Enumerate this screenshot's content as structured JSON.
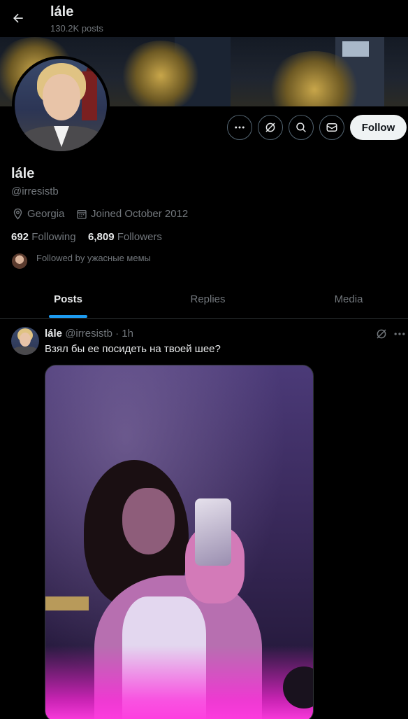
{
  "header": {
    "name": "lále",
    "post_count": "130.2K posts"
  },
  "profile": {
    "display_name": "lále",
    "handle": "@irresistb",
    "location": "Georgia",
    "joined": "Joined October 2012",
    "following_count": "692",
    "following_label": "Following",
    "followers_count": "6,809",
    "followers_label": "Followers",
    "followed_by": "Followed by ужасные мемы"
  },
  "actions": {
    "follow_label": "Follow",
    "icons": [
      "more-icon",
      "grok-icon",
      "search-icon",
      "message-icon"
    ]
  },
  "tabs": [
    {
      "label": "Posts",
      "active": true
    },
    {
      "label": "Replies",
      "active": false
    },
    {
      "label": "Media",
      "active": false
    }
  ],
  "post": {
    "author": "lále",
    "handle": "@irresistb",
    "separator": "·",
    "time": "1h",
    "text": "Взял бы ее посидеть на твоей шее?"
  },
  "colors": {
    "background": "#000000",
    "accent": "#1d9bf0",
    "muted": "#71767b",
    "text": "#e7e9ea",
    "follow_button": "#eff3f4"
  }
}
